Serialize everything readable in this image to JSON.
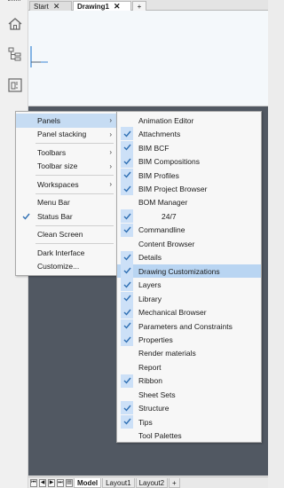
{
  "tabs": [
    {
      "label": "Start",
      "active": false
    },
    {
      "label": "Drawing1",
      "active": true
    }
  ],
  "tab_add": "+",
  "left_toolbar": {
    "icons": [
      "home-icon",
      "hierarchy-icon",
      "layout-icon"
    ]
  },
  "layout_tabs": [
    {
      "label": "Model",
      "active": true
    },
    {
      "label": "Layout1",
      "active": false
    },
    {
      "label": "Layout2",
      "active": false
    }
  ],
  "layout_add": "+",
  "context_menu": [
    {
      "label": "Panels",
      "submenu": true,
      "checked": false,
      "highlighted": true
    },
    {
      "label": "Panel stacking",
      "submenu": true,
      "checked": false
    },
    {
      "separator": true
    },
    {
      "label": "Toolbars",
      "submenu": true,
      "checked": false
    },
    {
      "label": "Toolbar size",
      "submenu": true,
      "checked": false
    },
    {
      "separator": true
    },
    {
      "label": "Workspaces",
      "submenu": true,
      "checked": false
    },
    {
      "separator": true
    },
    {
      "label": "Menu Bar",
      "submenu": false,
      "checked": false
    },
    {
      "label": "Status Bar",
      "submenu": false,
      "checked": true
    },
    {
      "separator": true
    },
    {
      "label": "Clean Screen",
      "submenu": false,
      "checked": false
    },
    {
      "separator": true
    },
    {
      "label": "Dark Interface",
      "submenu": false,
      "checked": false
    },
    {
      "label": "Customize...",
      "submenu": false,
      "checked": false
    }
  ],
  "panels_menu": [
    {
      "label": "Animation Editor",
      "checked": false
    },
    {
      "label": "Attachments",
      "checked": true
    },
    {
      "label": "BIM BCF",
      "checked": true
    },
    {
      "label": "BIM Compositions",
      "checked": true
    },
    {
      "label": "BIM Profiles",
      "checked": true
    },
    {
      "label": "BIM Project Browser",
      "checked": true
    },
    {
      "label": "BOM Manager",
      "checked": false
    },
    {
      "label": "24/7",
      "checked": true,
      "indented": true
    },
    {
      "label": "Commandline",
      "checked": true
    },
    {
      "label": "Content Browser",
      "checked": false
    },
    {
      "label": "Details",
      "checked": true
    },
    {
      "label": "Drawing Customizations",
      "checked": true,
      "highlighted": true
    },
    {
      "label": "Layers",
      "checked": true
    },
    {
      "label": "Library",
      "checked": true
    },
    {
      "label": "Mechanical Browser",
      "checked": true
    },
    {
      "label": "Parameters and Constraints",
      "checked": true
    },
    {
      "label": "Properties",
      "checked": true
    },
    {
      "label": "Render materials",
      "checked": false
    },
    {
      "label": "Report",
      "checked": false
    },
    {
      "label": "Ribbon",
      "checked": true
    },
    {
      "label": "Sheet Sets",
      "checked": false
    },
    {
      "label": "Structure",
      "checked": true
    },
    {
      "label": "Tips",
      "checked": true
    },
    {
      "label": "Tool Palettes",
      "checked": false
    }
  ],
  "colors": {
    "workspace": "#515862",
    "highlight": "#c6dcf3",
    "check": "#2f6fb3"
  }
}
